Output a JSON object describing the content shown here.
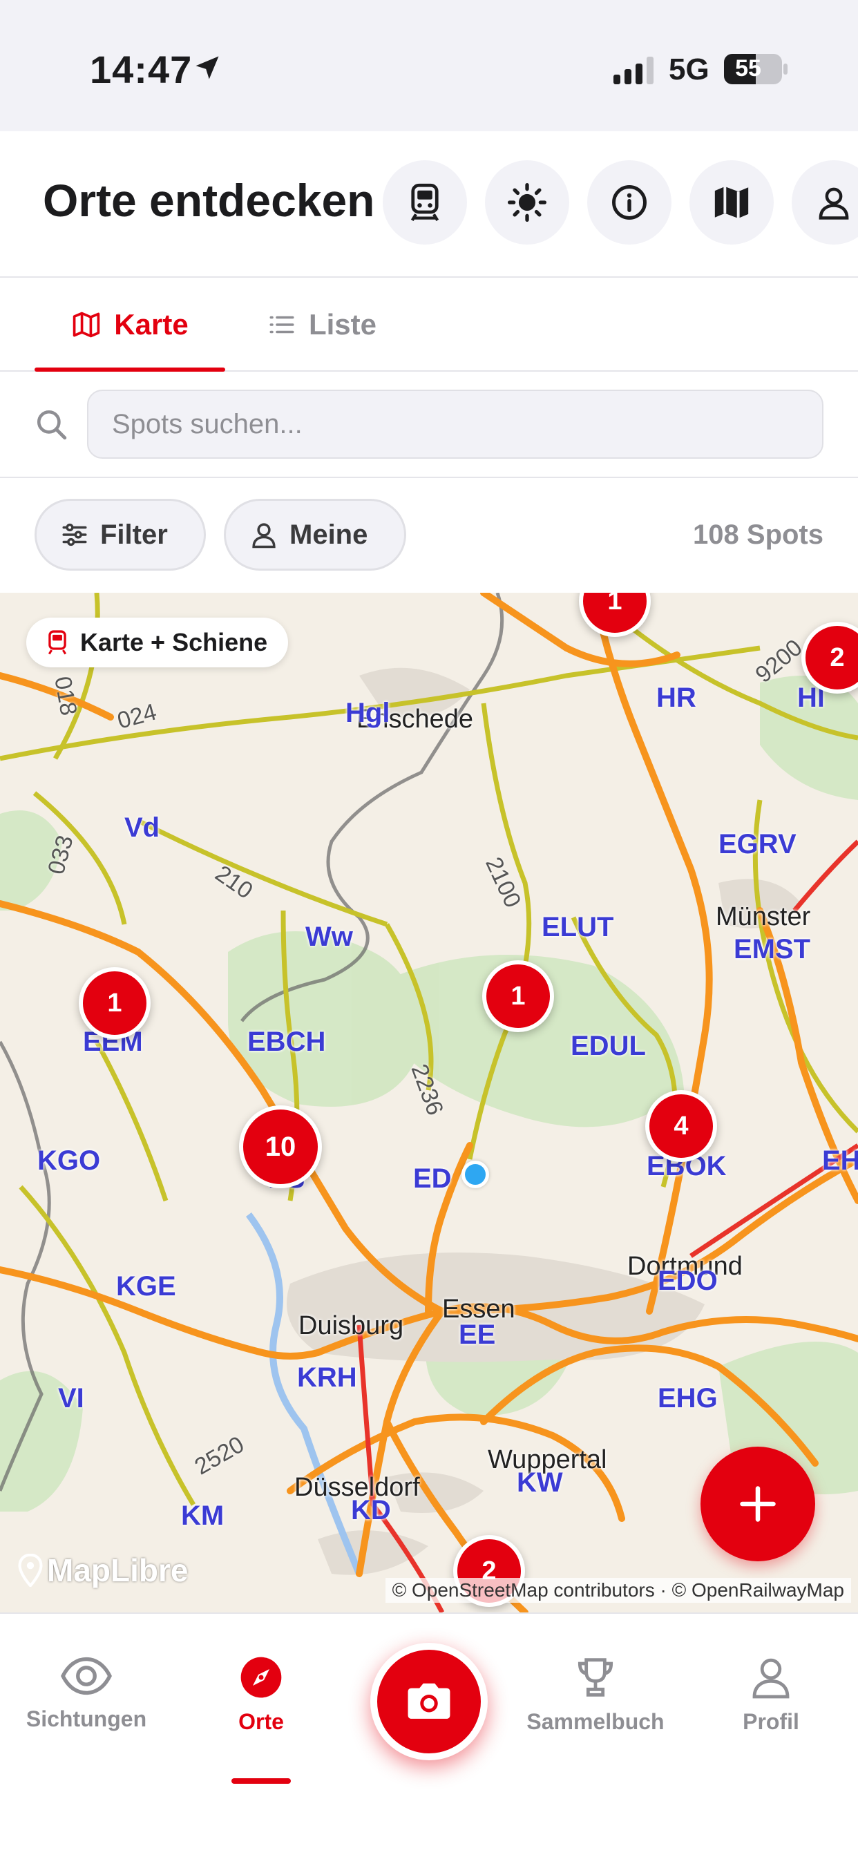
{
  "status_bar": {
    "time": "14:47",
    "network": "5G",
    "battery": "55"
  },
  "header": {
    "title": "Orte entdecken",
    "buttons": [
      "train-icon",
      "brightness-icon",
      "info-icon",
      "map-icon",
      "profile-icon"
    ]
  },
  "tabs": [
    {
      "label": "Karte",
      "icon": "map-outline-icon",
      "active": true
    },
    {
      "label": "Liste",
      "icon": "list-icon",
      "active": false
    }
  ],
  "search": {
    "placeholder": "Spots suchen...",
    "value": ""
  },
  "filters": {
    "filter_label": "Filter",
    "mine_label": "Meine",
    "spots_count": "108 Spots"
  },
  "map": {
    "layer_badge": "Karte + Schiene",
    "attribution": "© OpenStreetMap contributors · © OpenRailwayMap",
    "logo": "MapLibre",
    "clusters": [
      "1",
      "2",
      "1",
      "1",
      "10",
      "4",
      "2"
    ],
    "stations": [
      "Hgl",
      "HR",
      "Vd",
      "EGRV",
      "Ww",
      "ELUT",
      "EMST",
      "EBCH",
      "EDUL",
      "EEM",
      "KGO",
      "ES",
      "ED",
      "EBOK",
      "EH",
      "KGE",
      "EDO",
      "EE",
      "KRH",
      "VI",
      "EHG",
      "KW",
      "KM",
      "KD",
      "Hl"
    ],
    "cities": [
      "Enschede",
      "Münster",
      "Duisburg",
      "Essen",
      "Wuppertal",
      "Dortmund",
      "Düsseldorf"
    ],
    "line_numbers": [
      "024",
      "033",
      "210",
      "2100",
      "2236",
      "2520",
      "9200",
      "018"
    ]
  },
  "bottom_nav": [
    {
      "label": "Sichtungen",
      "icon": "eye-icon",
      "active": false
    },
    {
      "label": "Orte",
      "icon": "compass-icon",
      "active": true
    },
    {
      "label": "",
      "icon": "camera-icon",
      "active": false
    },
    {
      "label": "Sammelbuch",
      "icon": "trophy-icon",
      "active": false
    },
    {
      "label": "Profil",
      "icon": "person-icon",
      "active": false
    }
  ],
  "colors": {
    "accent": "#e3000f",
    "station_label": "#3b3bd4",
    "rail_main": "#f7941d",
    "rail_secondary": "#c7c22a"
  }
}
